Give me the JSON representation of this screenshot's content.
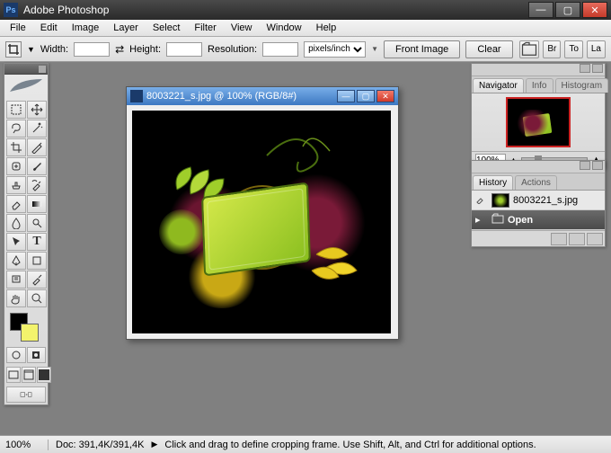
{
  "app": {
    "title": "Adobe Photoshop"
  },
  "menu": [
    "File",
    "Edit",
    "Image",
    "Layer",
    "Select",
    "Filter",
    "View",
    "Window",
    "Help"
  ],
  "options": {
    "width_label": "Width:",
    "height_label": "Height:",
    "resolution_label": "Resolution:",
    "units": "pixels/inch",
    "front_image": "Front Image",
    "clear": "Clear",
    "palette_btns": [
      "Br",
      "To",
      "La"
    ]
  },
  "tools": {
    "names": [
      "marquee",
      "move",
      "lasso",
      "magic-wand",
      "crop",
      "slice",
      "healing-brush",
      "brush",
      "clone-stamp",
      "history-brush",
      "eraser",
      "gradient",
      "blur",
      "dodge",
      "path-select",
      "type",
      "pen",
      "shape",
      "notes",
      "eyedropper",
      "hand",
      "zoom"
    ],
    "fg_color": "#000000",
    "bg_color": "#f3f36c"
  },
  "document": {
    "title": "8003221_s.jpg @ 100% (RGB/8#)"
  },
  "navigator": {
    "tabs": [
      "Navigator",
      "Info",
      "Histogram"
    ],
    "zoom": "100%"
  },
  "history": {
    "tabs": [
      "History",
      "Actions"
    ],
    "snapshot": "8003221_s.jpg",
    "state": "Open"
  },
  "status": {
    "zoom": "100%",
    "doc": "Doc: 391,4K/391,4K",
    "hint": "Click and drag to define cropping frame. Use Shift, Alt, and Ctrl for additional options."
  }
}
